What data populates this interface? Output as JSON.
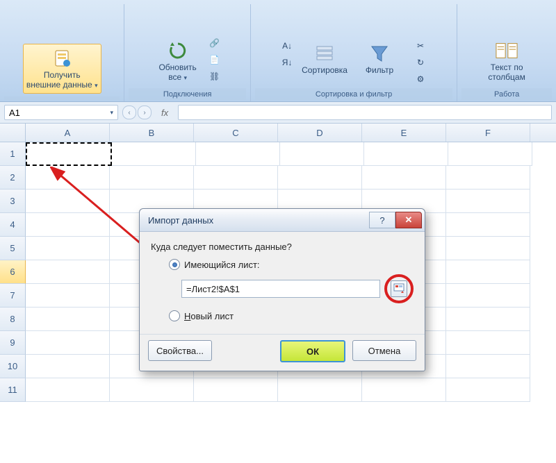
{
  "ribbon": {
    "groups": {
      "external": {
        "btn_label1": "Получить",
        "btn_label2": "внешние данные",
        "group_label": ""
      },
      "connections": {
        "refresh_label1": "Обновить",
        "refresh_label2": "все",
        "group_label": "Подключения"
      },
      "sortfilter": {
        "sort_asc": "А↓Я",
        "sort_desc": "Я↓А",
        "sort_label": "Сортировка",
        "filter_label": "Фильтр",
        "group_label": "Сортировка и фильтр"
      },
      "datatools": {
        "texttocol_label1": "Текст по",
        "texttocol_label2": "столбцам",
        "group_label": "Работа"
      }
    }
  },
  "formulabar": {
    "namebox": "A1",
    "fx": "fx",
    "formula": ""
  },
  "columns": [
    "A",
    "B",
    "C",
    "D",
    "E",
    "F"
  ],
  "rows": [
    "1",
    "2",
    "3",
    "4",
    "5",
    "6",
    "7",
    "8",
    "9",
    "10",
    "11"
  ],
  "highlight_row_index": 5,
  "dialog": {
    "title": "Импорт данных",
    "prompt": "Куда следует поместить данные?",
    "opt_existing": "Имеющийся лист:",
    "ref_value": "=Лист2!$A$1",
    "opt_new_prefix": "Н",
    "opt_new_rest": "овый лист",
    "btn_props": "Свойства...",
    "btn_ok": "ОК",
    "btn_cancel": "Отмена",
    "help_glyph": "?",
    "close_glyph": "✕"
  }
}
